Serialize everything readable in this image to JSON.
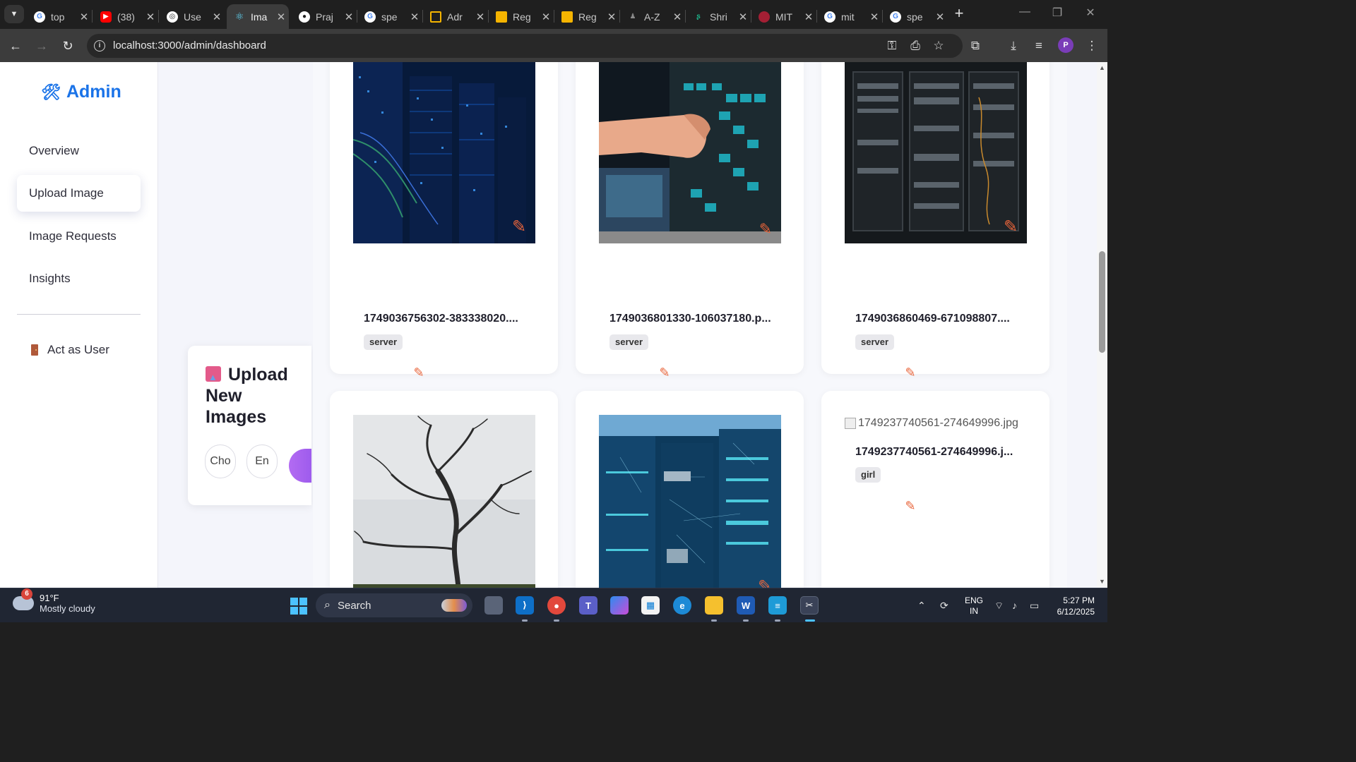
{
  "browser": {
    "tabs": [
      {
        "label": "top",
        "icon": "google-icon",
        "color": "#ffffff",
        "active": false
      },
      {
        "label": "(38)",
        "icon": "youtube-icon",
        "color": "#ff0000",
        "active": false
      },
      {
        "label": "Use",
        "icon": "openai-icon",
        "color": "#ffffff",
        "active": false
      },
      {
        "label": "Ima",
        "icon": "react-icon",
        "color": "#61dafb",
        "active": true
      },
      {
        "label": "Praj",
        "icon": "github-icon",
        "color": "#ffffff",
        "active": false
      },
      {
        "label": "spe",
        "icon": "google-icon",
        "color": "#ffffff",
        "active": false
      },
      {
        "label": "Adr",
        "icon": "note-icon",
        "color": "#f5b400",
        "active": false
      },
      {
        "label": "Reg",
        "icon": "note-icon",
        "color": "#f5b400",
        "active": false
      },
      {
        "label": "Reg",
        "icon": "note-icon",
        "color": "#f5b400",
        "active": false
      },
      {
        "label": "A-Z",
        "icon": "user-icon",
        "color": "#8a8a8a",
        "active": false
      },
      {
        "label": "Shri",
        "icon": "s-icon",
        "color": "#1db58b",
        "active": false
      },
      {
        "label": "MIT",
        "icon": "mit-icon",
        "color": "#a31f34",
        "active": false
      },
      {
        "label": "mit",
        "icon": "google-icon",
        "color": "#ffffff",
        "active": false
      },
      {
        "label": "spe",
        "icon": "google-icon",
        "color": "#ffffff",
        "active": false
      }
    ],
    "url": "localhost:3000/admin/dashboard",
    "profile_initial": "P"
  },
  "sidebar": {
    "brand": "Admin",
    "brand_icon": "tools-icon",
    "items": [
      {
        "label": "Overview",
        "active": false
      },
      {
        "label": "Upload Image",
        "active": true
      },
      {
        "label": "Image Requests",
        "active": false
      },
      {
        "label": "Insights",
        "active": false
      }
    ],
    "act_as_user": "Act as User"
  },
  "upload": {
    "title": "Upload New Images",
    "choose_label": "Cho",
    "enter_label": "En"
  },
  "gallery": {
    "cards": [
      {
        "filename": "1749036756302-383338020....",
        "tag": "server",
        "image": "server-room-blue"
      },
      {
        "filename": "1749036801330-106037180.p...",
        "tag": "server",
        "image": "hand-on-server-rack"
      },
      {
        "filename": "1749036860469-671098807....",
        "tag": "server",
        "image": "server-racks-dark"
      },
      {
        "filename": "",
        "tag": "",
        "image": "bare-tree"
      },
      {
        "filename": "",
        "tag": "",
        "image": "datacenter-network"
      },
      {
        "filename": "1749237740561-274649996.j...",
        "tag": "girl",
        "image": "broken-image",
        "alt": "1749237740561-274649996.jpg"
      }
    ]
  },
  "taskbar": {
    "weather_temp": "91°F",
    "weather_desc": "Mostly cloudy",
    "weather_badge": "6",
    "search_placeholder": "Search",
    "lang_top": "ENG",
    "lang_bottom": "IN",
    "time": "5:27 PM",
    "date": "6/12/2025"
  },
  "colors": {
    "accent": "#1a73e8",
    "edit": "#e8643a",
    "upload_gradient": "#b36bf2"
  }
}
